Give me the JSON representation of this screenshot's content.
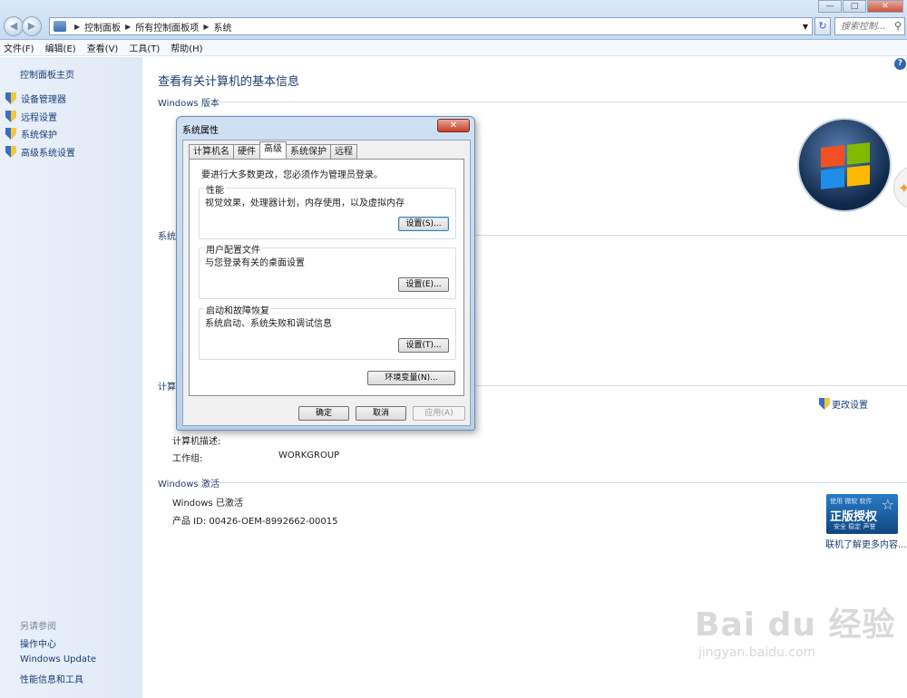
{
  "window": {
    "breadcrumbs": [
      "控制面板",
      "所有控制面板项",
      "系统"
    ],
    "search_placeholder": "搜索控制...",
    "controls": {
      "minimize": "—",
      "maximize": "□",
      "close": "✕"
    }
  },
  "menu": [
    "文件(F)",
    "编辑(E)",
    "查看(V)",
    "工具(T)",
    "帮助(H)"
  ],
  "sidebar": {
    "home": "控制面板主页",
    "tasks": [
      "设备管理器",
      "远程设置",
      "系统保护",
      "高级系统设置"
    ],
    "see_also_title": "另请参阅",
    "see_also": [
      "操作中心",
      "Windows Update",
      "性能信息和工具"
    ]
  },
  "main": {
    "heading": "查看有关计算机的基本信息",
    "sections": {
      "edition": "Windows 版本",
      "system": "系统",
      "computer": "计算机",
      "activation": "Windows 激活"
    },
    "computer_rows": [
      {
        "label": "计算机描述:",
        "value": ""
      },
      {
        "label": "工作组:",
        "value": "WORKGROUP"
      }
    ],
    "change_settings": "更改设置",
    "activation_status": "Windows 已激活",
    "product_id": "产品 ID: 00426-OEM-8992662-00015",
    "genuine": {
      "line1": "使用 微软 软件",
      "line2": "正版授权",
      "line3": "安全 稳定 声誉"
    },
    "more_link": "联机了解更多内容..."
  },
  "dialog": {
    "title": "系统属性",
    "tabs": [
      "计算机名",
      "硬件",
      "高级",
      "系统保护",
      "远程"
    ],
    "active_tab": "高级",
    "admin_note": "要进行大多数更改，您必须作为管理员登录。",
    "groups": [
      {
        "title": "性能",
        "desc": "视觉效果，处理器计划，内存使用，以及虚拟内存",
        "button": "设置(S)..."
      },
      {
        "title": "用户配置文件",
        "desc": "与您登录有关的桌面设置",
        "button": "设置(E)..."
      },
      {
        "title": "启动和故障恢复",
        "desc": "系统启动、系统失败和调试信息",
        "button": "设置(T)..."
      }
    ],
    "env_button": "环境变量(N)...",
    "ok": "确定",
    "cancel": "取消",
    "apply": "应用(A)"
  },
  "watermark": {
    "brand": "Bai du 经验",
    "url": "jingyan.baidu.com"
  },
  "colors": {
    "link": "#1a3f78",
    "sidebar_bg": "#e3ecf7",
    "dialog_frame": "#b9d0ea"
  }
}
